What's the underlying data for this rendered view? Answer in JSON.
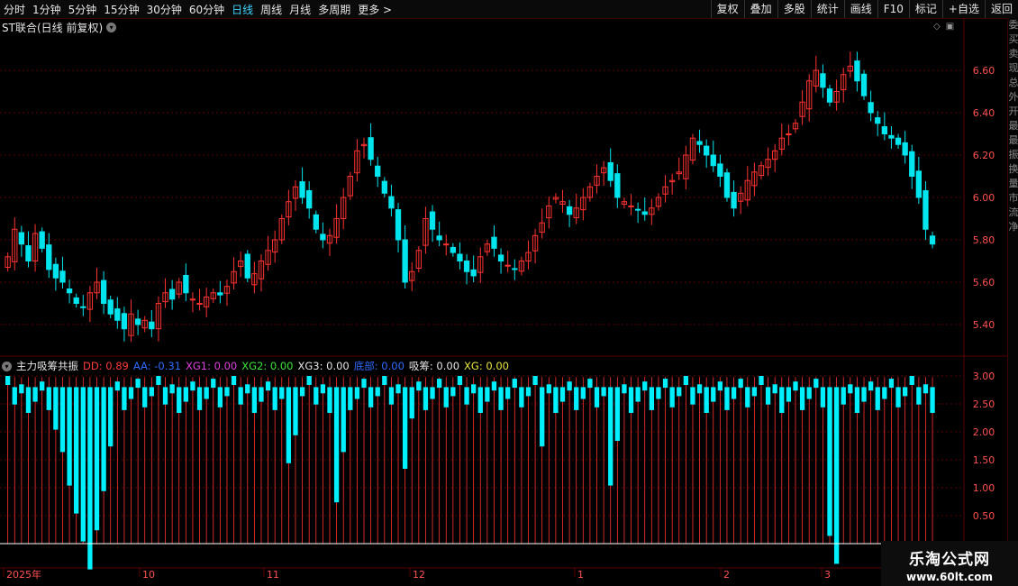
{
  "menu": {
    "left": [
      "分时",
      "1分钟",
      "5分钟",
      "15分钟",
      "30分钟",
      "60分钟",
      "日线",
      "周线",
      "月线",
      "多周期",
      "更多 >"
    ],
    "active": "日线",
    "right": [
      "复权",
      "叠加",
      "多股",
      "统计",
      "画线",
      "F10",
      "标记",
      "+自选",
      "返回"
    ]
  },
  "title": "ST联合(日线 前复权)",
  "indicator": {
    "name": "主力吸筹共振",
    "items": [
      {
        "label": "DD:",
        "value": "0.89",
        "color": "#ff3b3b"
      },
      {
        "label": "AA:",
        "value": "-0.31",
        "color": "#2f6bff"
      },
      {
        "label": "XG1:",
        "value": "0.00",
        "color": "#e040e0"
      },
      {
        "label": "XG2:",
        "value": "0.00",
        "color": "#39e639"
      },
      {
        "label": "XG3:",
        "value": "0.00",
        "color": "#e6e6e6"
      },
      {
        "label": "底部:",
        "value": "0.00",
        "color": "#2f6bff"
      },
      {
        "label": "吸筹:",
        "value": "0.00",
        "color": "#e6e6e6"
      },
      {
        "label": "XG:",
        "value": "0.00",
        "color": "#e6e640"
      }
    ]
  },
  "price_axis": [
    "6.60",
    "6.40",
    "6.20",
    "6.00",
    "5.80",
    "5.60",
    "5.40"
  ],
  "ind_axis": [
    "3.00",
    "2.50",
    "2.00",
    "1.50",
    "1.00",
    "0.50"
  ],
  "date_axis": [
    "2025年",
    "10",
    "11",
    "12",
    "1",
    "2",
    "3"
  ],
  "sidebar_chars": [
    "委",
    "买",
    "卖",
    "现",
    "总",
    "外",
    "开",
    "最",
    "最",
    "振",
    "换",
    "量",
    "市",
    "流",
    "净"
  ],
  "logo": {
    "line1": "乐淘公式网",
    "line2": "www.60lt.com"
  },
  "colors": {
    "up": "#ff3232",
    "down": "#00e5ee",
    "grid": "#5a0000",
    "axis_text": "#ff5050"
  },
  "chart_data": {
    "type": "candlestick",
    "price_ticks": [
      6.6,
      6.4,
      6.2,
      6.0,
      5.8,
      5.6,
      5.4
    ],
    "indicator_ticks": [
      3.0,
      2.5,
      2.0,
      1.5,
      1.0,
      0.5
    ]
  }
}
